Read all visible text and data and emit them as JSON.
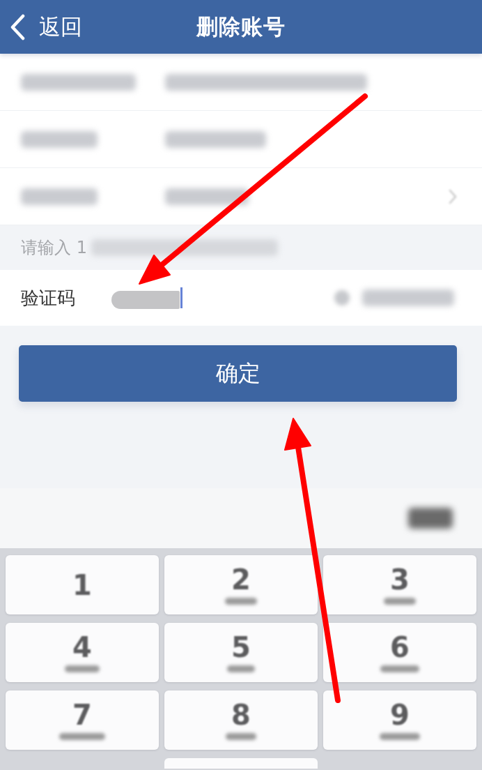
{
  "header": {
    "back_label": "返回",
    "title": "删除账号"
  },
  "info_rows": [
    {
      "chevron": false
    },
    {
      "chevron": false
    },
    {
      "chevron": true
    }
  ],
  "hint": {
    "text": "请输入 1"
  },
  "code_field": {
    "label": "验证码",
    "value_redacted": true,
    "focused": true
  },
  "confirm_button": {
    "label": "确定"
  },
  "keyboard": {
    "keys": [
      {
        "digit": "1",
        "subtitle_blurred": false
      },
      {
        "digit": "2",
        "subtitle_blurred": true
      },
      {
        "digit": "3",
        "subtitle_blurred": true
      },
      {
        "digit": "4",
        "subtitle_blurred": true
      },
      {
        "digit": "5",
        "subtitle_blurred": true
      },
      {
        "digit": "6",
        "subtitle_blurred": true
      },
      {
        "digit": "7",
        "subtitle_blurred": true
      },
      {
        "digit": "8",
        "subtitle_blurred": true
      },
      {
        "digit": "9",
        "subtitle_blurred": true
      }
    ]
  },
  "annotations": [
    {
      "kind": "arrow"
    },
    {
      "kind": "arrow"
    }
  ]
}
